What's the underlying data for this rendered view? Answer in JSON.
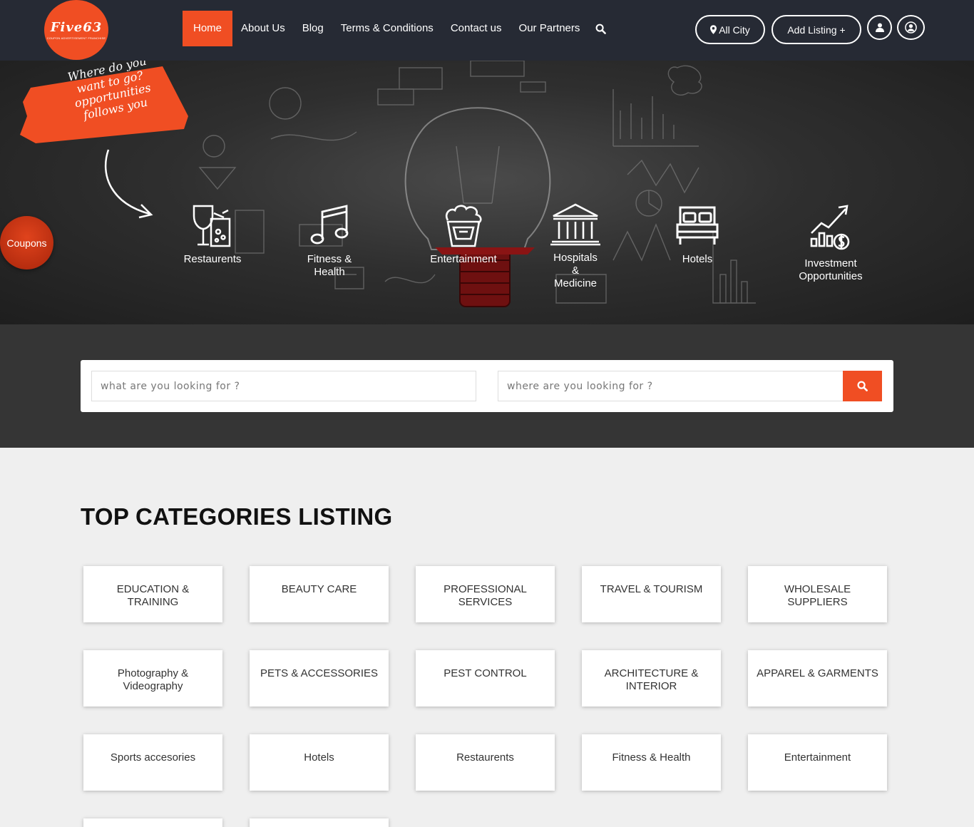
{
  "header": {
    "logo_text": "Five63",
    "logo_subtext": "COUPON ADVERTISEMENT FRANCHISE",
    "nav": [
      "Home",
      "About Us",
      "Blog",
      "Terms & Conditions",
      "Contact us",
      "Our Partners"
    ],
    "active_nav": "Home",
    "all_city_label": "All City",
    "add_listing_label": "Add Listing +",
    "accent_color": "#f04e23"
  },
  "hero": {
    "tagline_lines": [
      "Where do you",
      "want to go?",
      "opportunities",
      "follows you"
    ],
    "categories": [
      {
        "label": "Restaurents",
        "icon": "cocktail-icon"
      },
      {
        "label": "Fitness & Health",
        "icon": "music-note-icon"
      },
      {
        "label": "Entertainment",
        "icon": "popcorn-icon"
      },
      {
        "label": "Hospitals & Medicine",
        "icon": "hospital-building-icon"
      },
      {
        "label": "Hotels",
        "icon": "bed-icon"
      },
      {
        "label": "Investment Opportunities",
        "icon": "investment-chart-icon"
      }
    ],
    "coupons_label": "Coupons"
  },
  "search": {
    "what_placeholder": "what are you looking for ?",
    "where_placeholder": "where are you looking for ?"
  },
  "categories": {
    "title": "TOP CATEGORIES LISTING",
    "items": [
      "EDUCATION & TRAINING",
      "BEAUTY CARE",
      "PROFESSIONAL SERVICES",
      "TRAVEL & TOURISM",
      "WHOLESALE SUPPLIERS",
      "Photography & Videography",
      "PETS & ACCESSORIES",
      "PEST CONTROL",
      "ARCHITECTURE & INTERIOR",
      "APPAREL & GARMENTS",
      "Sports accesories",
      "Hotels",
      "Restaurents",
      "Fitness & Health",
      "Entertainment",
      "",
      ""
    ]
  }
}
